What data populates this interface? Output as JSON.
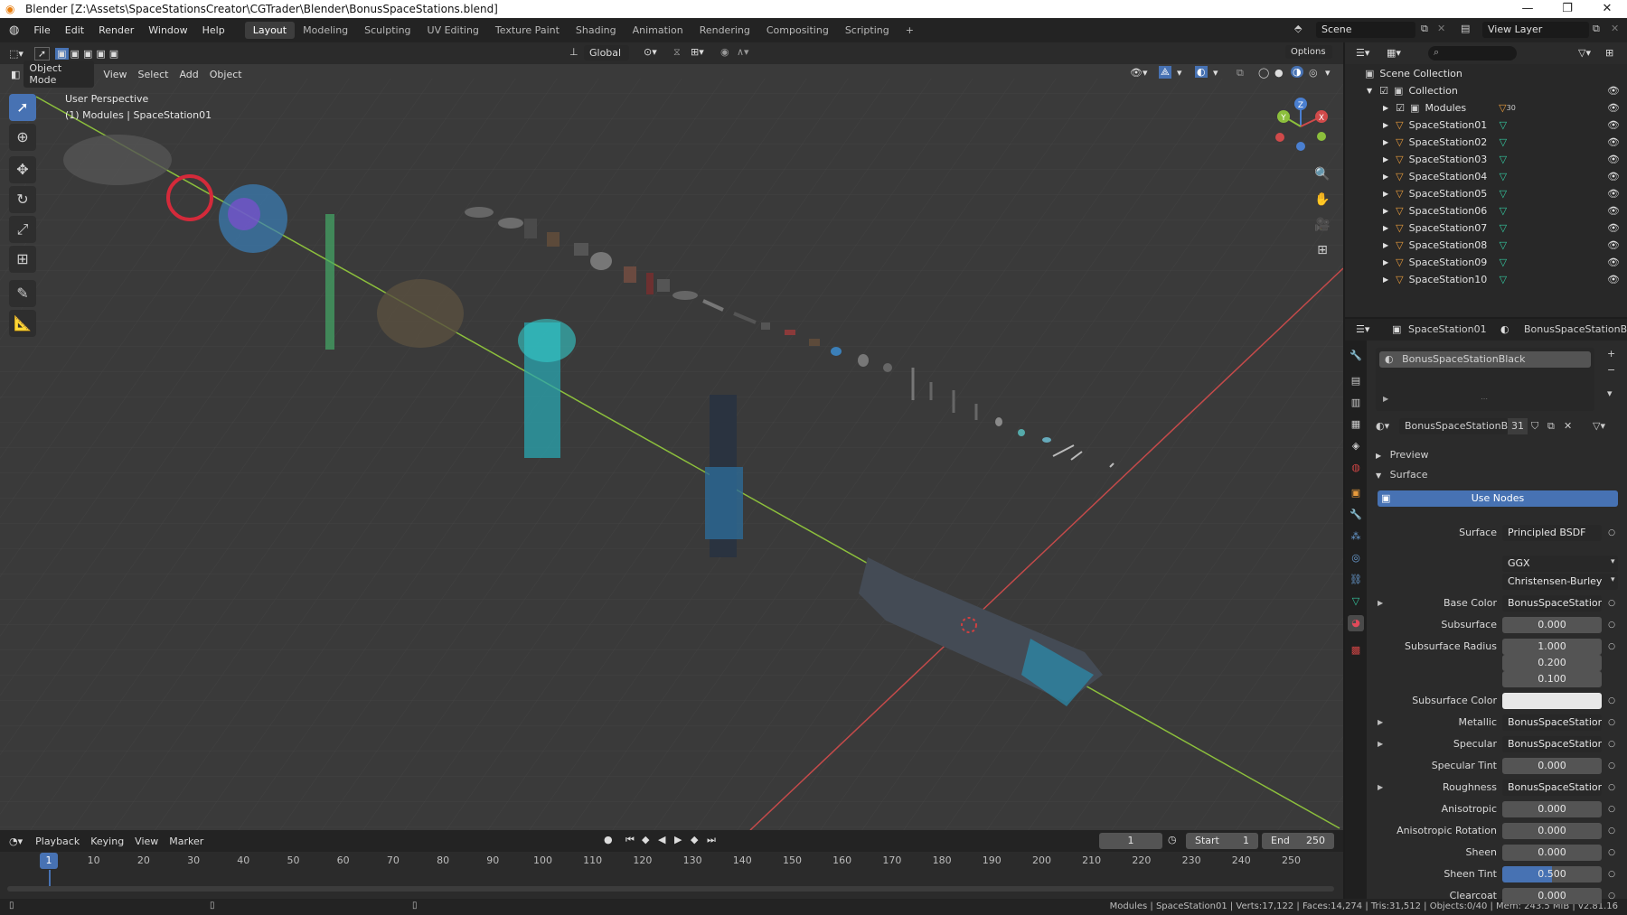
{
  "window": {
    "title": "Blender [Z:\\Assets\\SpaceStationsCreator\\CGTrader\\Blender\\BonusSpaceStations.blend]",
    "controls": [
      "—",
      "❐",
      "✕"
    ]
  },
  "menu": {
    "items": [
      "File",
      "Edit",
      "Render",
      "Window",
      "Help"
    ],
    "workspaces": [
      "Layout",
      "Modeling",
      "Sculpting",
      "UV Editing",
      "Texture Paint",
      "Shading",
      "Animation",
      "Rendering",
      "Compositing",
      "Scripting"
    ],
    "active_workspace": "Layout",
    "add_tab": "+",
    "scene": "Scene",
    "view_layer": "View Layer"
  },
  "viewport": {
    "mode": "Object Mode",
    "menus": [
      "View",
      "Select",
      "Add",
      "Object"
    ],
    "orientation": "Global",
    "options_label": "Options",
    "info_line1": "User Perspective",
    "info_line2": "(1) Modules | SpaceStation01",
    "gizmo": {
      "x": "X",
      "y": "Y",
      "z": "Z"
    }
  },
  "timeline": {
    "menus": [
      "Playback",
      "Keying",
      "View",
      "Marker"
    ],
    "current_frame": "1",
    "start_label": "Start",
    "start_value": "1",
    "end_label": "End",
    "end_value": "250",
    "ruler": [
      "1",
      "10",
      "20",
      "30",
      "40",
      "50",
      "60",
      "70",
      "80",
      "90",
      "100",
      "110",
      "120",
      "130",
      "140",
      "150",
      "160",
      "170",
      "180",
      "190",
      "200",
      "210",
      "220",
      "230",
      "240",
      "250"
    ]
  },
  "statusbar": {
    "text": "Modules | SpaceStation01 | Verts:17,122 | Faces:14,274 | Tris:31,512 | Objects:0/40 | Mem: 243.5 MiB | v2.81.16"
  },
  "outliner": {
    "root": "Scene Collection",
    "collection": "Collection",
    "modules": "Modules",
    "modules_count": "30",
    "objects": [
      "SpaceStation01",
      "SpaceStation02",
      "SpaceStation03",
      "SpaceStation04",
      "SpaceStation05",
      "SpaceStation06",
      "SpaceStation07",
      "SpaceStation08",
      "SpaceStation09",
      "SpaceStation10"
    ]
  },
  "properties": {
    "object_name": "SpaceStation01",
    "material_name": "BonusSpaceStationBlack",
    "slot_name": "BonusSpaceStationBlack",
    "material_field": "BonusSpaceStationBl...",
    "users": "31",
    "panels": {
      "preview": "Preview",
      "surface": "Surface"
    },
    "use_nodes": "Use Nodes",
    "rows": [
      {
        "label": "Surface",
        "value": "Principled BSDF",
        "kind": "dark"
      },
      {
        "label": "",
        "value": "GGX",
        "kind": "drop"
      },
      {
        "label": "",
        "value": "Christensen-Burley",
        "kind": "drop"
      },
      {
        "label": "Base Color",
        "value": "BonusSpaceStations...",
        "kind": "dark",
        "arrow": true
      },
      {
        "label": "Subsurface",
        "value": "0.000",
        "kind": "num"
      },
      {
        "label": "Subsurface Radius",
        "value": "1.000",
        "kind": "num"
      },
      {
        "label": "",
        "value": "0.200",
        "kind": "num"
      },
      {
        "label": "",
        "value": "0.100",
        "kind": "num"
      },
      {
        "label": "Subsurface Color",
        "value": "",
        "kind": "color"
      },
      {
        "label": "Metallic",
        "value": "BonusSpaceStations...",
        "kind": "dark",
        "arrow": true
      },
      {
        "label": "Specular",
        "value": "BonusSpaceStations...",
        "kind": "dark",
        "arrow": true
      },
      {
        "label": "Specular Tint",
        "value": "0.000",
        "kind": "num"
      },
      {
        "label": "Roughness",
        "value": "BonusSpaceStations...",
        "kind": "dark",
        "arrow": true
      },
      {
        "label": "Anisotropic",
        "value": "0.000",
        "kind": "num"
      },
      {
        "label": "Anisotropic Rotation",
        "value": "0.000",
        "kind": "num"
      },
      {
        "label": "Sheen",
        "value": "0.000",
        "kind": "num"
      },
      {
        "label": "Sheen Tint",
        "value": "0.500",
        "kind": "slider"
      },
      {
        "label": "Clearcoat",
        "value": "0.000",
        "kind": "num"
      }
    ]
  },
  "colors": {
    "accent": "#4772b3",
    "x_axis": "#c44a4a",
    "y_axis": "#8cbf3c",
    "object_orange": "#e89b3c",
    "mesh_green": "#35c9a0"
  }
}
